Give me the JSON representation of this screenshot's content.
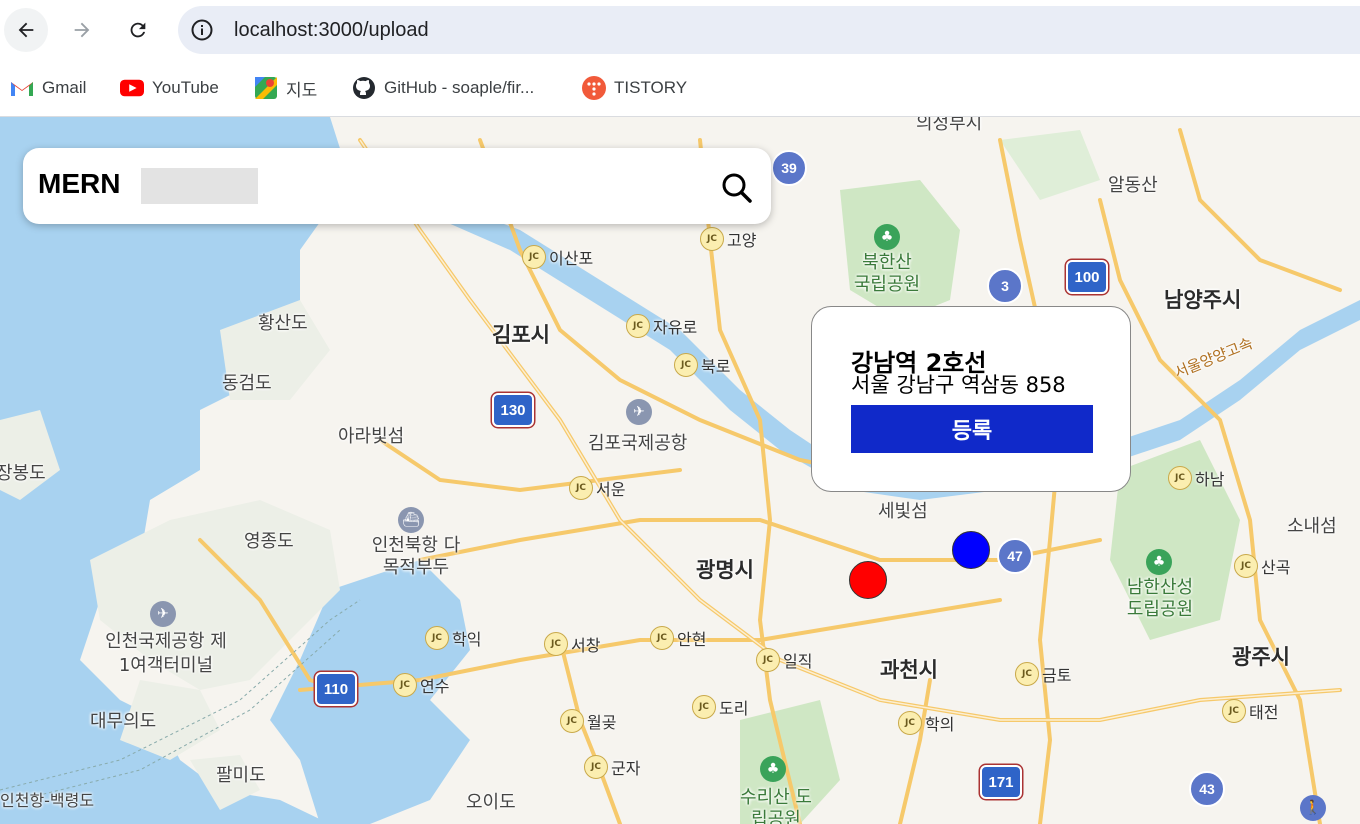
{
  "browser": {
    "url": "localhost:3000/upload",
    "bookmarks": [
      {
        "label": "Gmail",
        "icon": "gmail-icon"
      },
      {
        "label": "YouTube",
        "icon": "youtube-icon"
      },
      {
        "label": "지도",
        "icon": "google-maps-icon"
      },
      {
        "label": "GitHub - soaple/fir...",
        "icon": "github-icon"
      },
      {
        "label": "TISTORY",
        "icon": "tistory-icon"
      }
    ]
  },
  "search": {
    "brand": "MERN",
    "value": "",
    "icon": "search-icon"
  },
  "popup": {
    "title": "강남역 2호선",
    "address": "서울 강남구 역삼동 858",
    "button": "등록",
    "button_color": "#1029c9"
  },
  "markers": [
    {
      "name": "red-marker",
      "color": "#ff0000"
    },
    {
      "name": "blue-marker",
      "color": "#0000ff"
    }
  ],
  "map": {
    "cities": [
      "김포시",
      "광명시",
      "과천시",
      "남양주시",
      "광주시"
    ],
    "towns": [
      "의정부시",
      "알동산",
      "황산도",
      "동검도",
      "아라빛섬",
      "장봉도",
      "영종도",
      "인천북항 다목적부두",
      "인천국제공항 제1여객터미널",
      "대무의도",
      "팔미도",
      "인천항-백령도",
      "오이도",
      "북한산 국립공원",
      "남한산성 도립공원",
      "수리산 도립공원",
      "세빛섬",
      "김포국제공항",
      "소내섬",
      "서울양양고속"
    ],
    "junctions": [
      "이산포",
      "고양",
      "자유로",
      "북로",
      "서운",
      "학익",
      "서창",
      "안현",
      "일직",
      "연수",
      "월곶",
      "도리",
      "군자",
      "학의",
      "금토",
      "하남",
      "산곡",
      "태전"
    ],
    "highways": [
      "39",
      "130",
      "110",
      "100",
      "3",
      "47",
      "171",
      "43"
    ]
  }
}
